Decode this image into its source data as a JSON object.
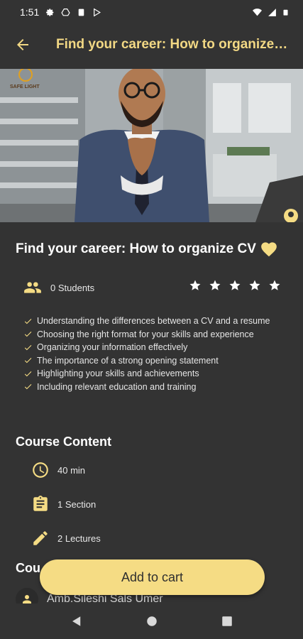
{
  "status_bar": {
    "time": "1:51",
    "icons": [
      "gear-icon",
      "drive-icon",
      "clipboard-icon",
      "play-store-icon",
      "wifi-icon",
      "signal-icon",
      "battery-icon"
    ]
  },
  "app_bar": {
    "title": "Find your career: How to organize C...",
    "back_icon": "arrow-left-icon"
  },
  "hero": {
    "logo_text": "SAFE LIGHT"
  },
  "course": {
    "title": "Find your career: How to organize CV",
    "favorite_icon": "heart-icon",
    "students": "0 Students",
    "rating_stars": 5,
    "outcomes": [
      "Understanding the differences between a CV and a resume",
      "Choosing the right format for your skills and experience",
      "Organizing your information effectively",
      "The importance of a strong opening statement",
      "Highlighting your skills and achievements",
      "Including relevant education and training"
    ]
  },
  "course_content": {
    "heading": "Course Content",
    "items": [
      {
        "icon": "clock-icon",
        "label": "40 min"
      },
      {
        "icon": "assignment-icon",
        "label": "1 Section"
      },
      {
        "icon": "pencil-icon",
        "label": "2 Lectures"
      }
    ]
  },
  "instructor_section": {
    "heading_visible": "Cou",
    "name": "Amb.Sileshi Sals Umer"
  },
  "cta": {
    "label": "Add to cart"
  },
  "colors": {
    "background": "#333333",
    "accent": "#f5dc84",
    "title_accent": "#f2d884"
  },
  "nav_bar": {
    "icons": [
      "back-triangle-icon",
      "home-circle-icon",
      "recents-square-icon"
    ]
  }
}
